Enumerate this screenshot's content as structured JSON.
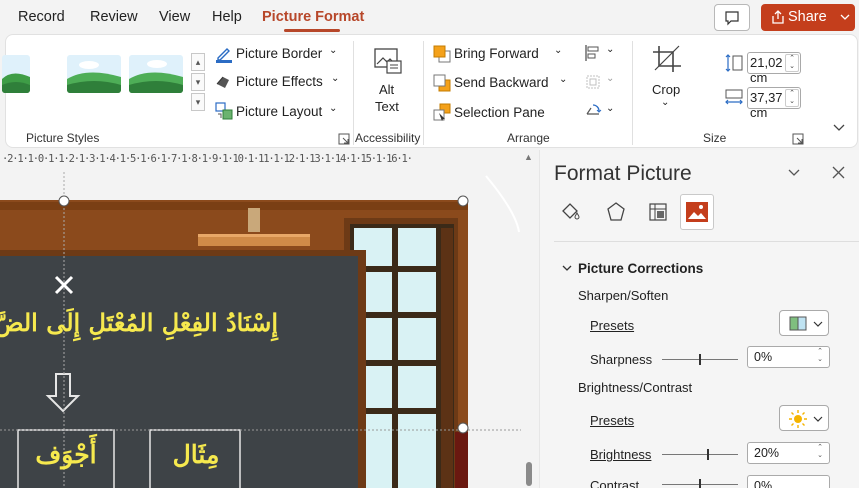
{
  "tabs": [
    {
      "label": "Record",
      "active": false
    },
    {
      "label": "Review",
      "active": false
    },
    {
      "label": "View",
      "active": false
    },
    {
      "label": "Help",
      "active": false
    },
    {
      "label": "Picture Format",
      "active": true
    }
  ],
  "share_label": "Share",
  "ribbon": {
    "adjust": {
      "picture_border": "Picture Border",
      "picture_effects": "Picture Effects",
      "picture_layout": "Picture Layout",
      "group_label": "Picture Styles"
    },
    "accessibility": {
      "alt_text_line1": "Alt",
      "alt_text_line2": "Text",
      "group_label": "Accessibility"
    },
    "arrange": {
      "bring_forward": "Bring Forward",
      "send_backward": "Send Backward",
      "selection_pane": "Selection Pane",
      "group_label": "Arrange"
    },
    "size": {
      "crop_label": "Crop",
      "height_value": "21,02 cm",
      "width_value": "37,37 cm",
      "group_label": "Size"
    }
  },
  "ruler_text": "·2·1·1·0·1·1·2·1·3·1·4·1·5·1·6·1·7·1·8·1·9·1·10·1·11·1·12·1·13·1·14·1·15·1·16·1·",
  "slide": {
    "title_text": "إِسْنَادُ الفِعْلِ المُعْتَلِ إِلَى الضَّ",
    "box1_text": "أَجْوَف",
    "box2_text": "مِثَال"
  },
  "pane": {
    "title": "Format Picture",
    "tab_icons": [
      "fill-line-icon",
      "effects-icon",
      "size-properties-icon",
      "picture-icon"
    ],
    "section_title": "Picture Corrections",
    "sharpen_soften": "Sharpen/Soften",
    "presets_1": "Presets",
    "sharpness_label": "Sharpness",
    "sharpness_value": "0%",
    "brightness_contrast": "Brightness/Contrast",
    "presets_2": "Presets",
    "brightness_label": "Brightness",
    "brightness_value": "20%",
    "contrast_label": "Contrast",
    "contrast_value": "0%"
  },
  "colors": {
    "accent": "#b7472a",
    "share": "#c43e1c",
    "chalkboard": "#3e4347",
    "wood": "#8b4a1c",
    "chalk_text": "#f6e94e"
  }
}
